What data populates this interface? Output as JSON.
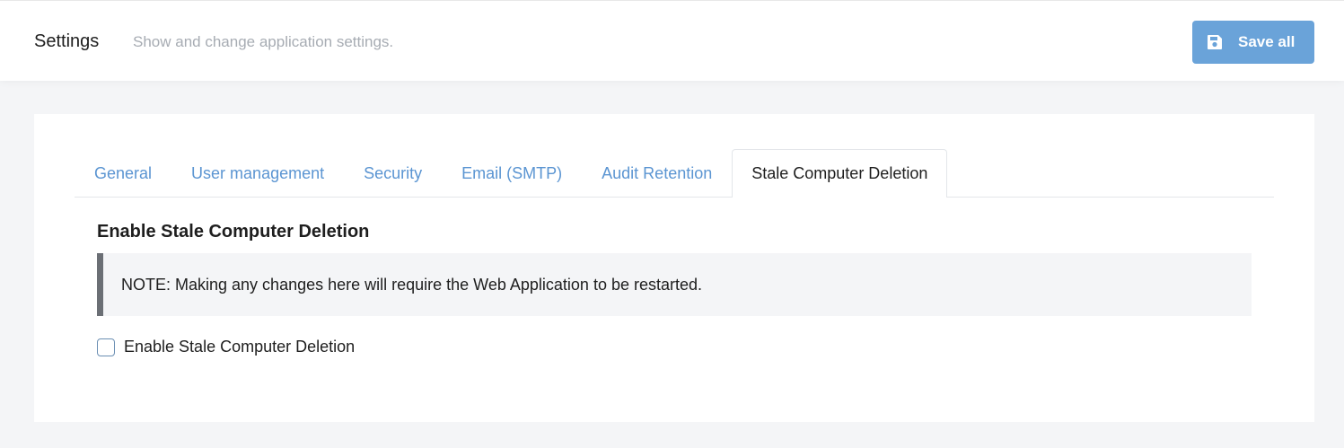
{
  "header": {
    "title": "Settings",
    "subtitle": "Show and change application settings.",
    "save_label": "Save all",
    "save_icon": "floppy-disk-icon"
  },
  "tabs": [
    {
      "label": "General",
      "active": false
    },
    {
      "label": "User management",
      "active": false
    },
    {
      "label": "Security",
      "active": false
    },
    {
      "label": "Email (SMTP)",
      "active": false
    },
    {
      "label": "Audit Retention",
      "active": false
    },
    {
      "label": "Stale Computer Deletion",
      "active": true
    }
  ],
  "section": {
    "title": "Enable Stale Computer Deletion",
    "note": "NOTE: Making any changes here will require the Web Application to be restarted.",
    "checkbox_label": "Enable Stale Computer Deletion",
    "checkbox_checked": false
  },
  "colors": {
    "accent": "#6aa3d9",
    "tab_link": "#5b95d2",
    "note_border": "#6b6f75",
    "background": "#f4f5f7"
  }
}
